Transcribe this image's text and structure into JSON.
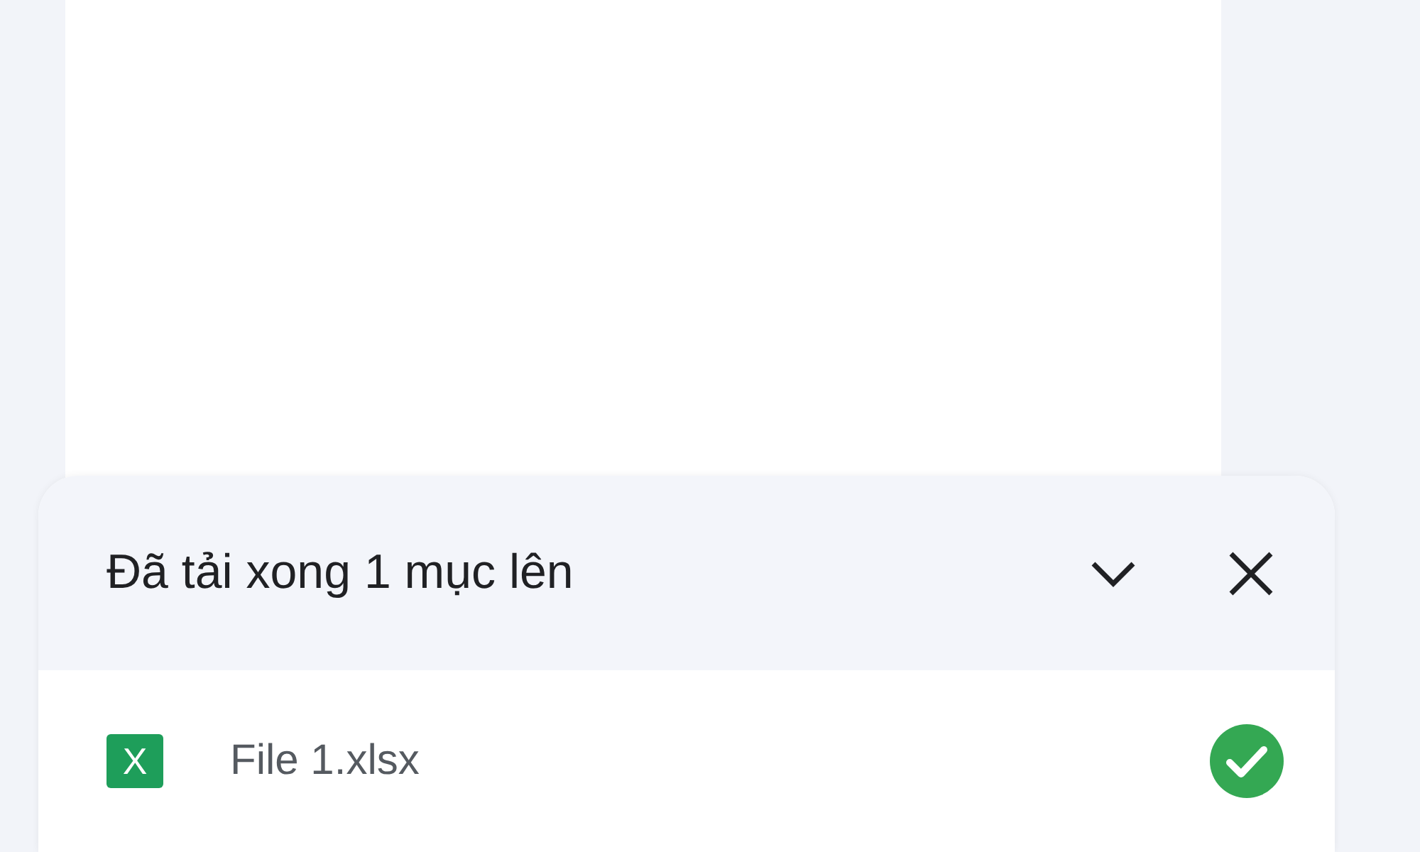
{
  "upload_panel": {
    "title": "Đã tải xong 1 mục lên",
    "items": [
      {
        "icon_letter": "X",
        "name": "File 1.xlsx",
        "done": true
      }
    ]
  }
}
